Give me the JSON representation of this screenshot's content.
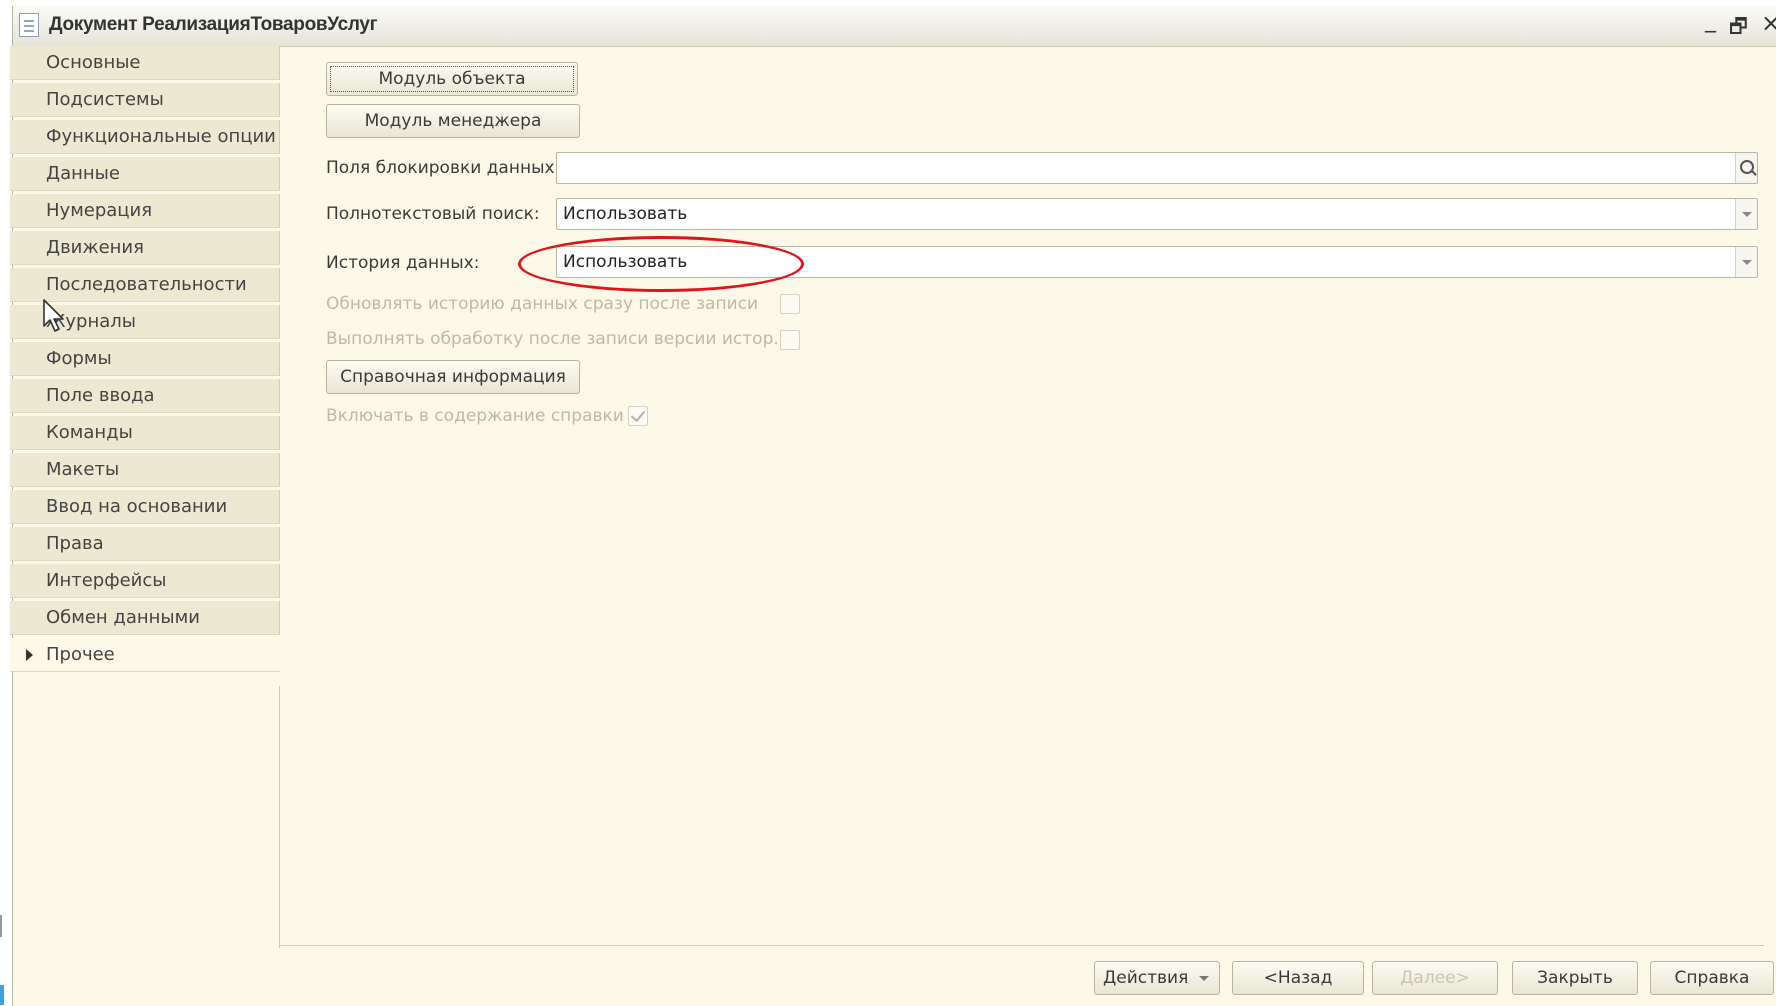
{
  "window": {
    "title": "Документ РеализацияТоваровУслуг",
    "minimize_glyph": "_",
    "restore_glyph": "🗗",
    "close_glyph": "×"
  },
  "sidebar": {
    "items": [
      {
        "label": "Основные"
      },
      {
        "label": "Подсистемы"
      },
      {
        "label": "Функциональные опции"
      },
      {
        "label": "Данные"
      },
      {
        "label": "Нумерация"
      },
      {
        "label": "Движения"
      },
      {
        "label": "Последовательности"
      },
      {
        "label": "Журналы"
      },
      {
        "label": "Формы"
      },
      {
        "label": "Поле ввода"
      },
      {
        "label": "Команды"
      },
      {
        "label": "Макеты"
      },
      {
        "label": "Ввод на основании"
      },
      {
        "label": "Права"
      },
      {
        "label": "Интерфейсы"
      },
      {
        "label": "Обмен данными"
      },
      {
        "label": "Прочее"
      }
    ],
    "active_index": 16
  },
  "main": {
    "object_module_button": "Модуль объекта",
    "manager_module_button": "Модуль менеджера",
    "lock_fields": {
      "label": "Поля блокировки данных:",
      "value": ""
    },
    "fulltext_search": {
      "label": "Полнотекстовый поиск:",
      "value": "Использовать"
    },
    "data_history": {
      "label": "История данных:",
      "value": "Использовать"
    },
    "update_history_checkbox": {
      "label": "Обновлять историю данных сразу после записи",
      "checked": false
    },
    "process_after_write_checkbox": {
      "label": "Выполнять обработку после записи версии истор...",
      "checked": false
    },
    "help_info_button": "Справочная информация",
    "include_in_help_checkbox": {
      "label": "Включать в содержание справки",
      "checked": true
    }
  },
  "footer": {
    "actions": "Действия",
    "back": "<Назад",
    "next": "Далее>",
    "close": "Закрыть",
    "help": "Справка"
  },
  "annotation": {
    "highlight_color": "#e0141b"
  }
}
